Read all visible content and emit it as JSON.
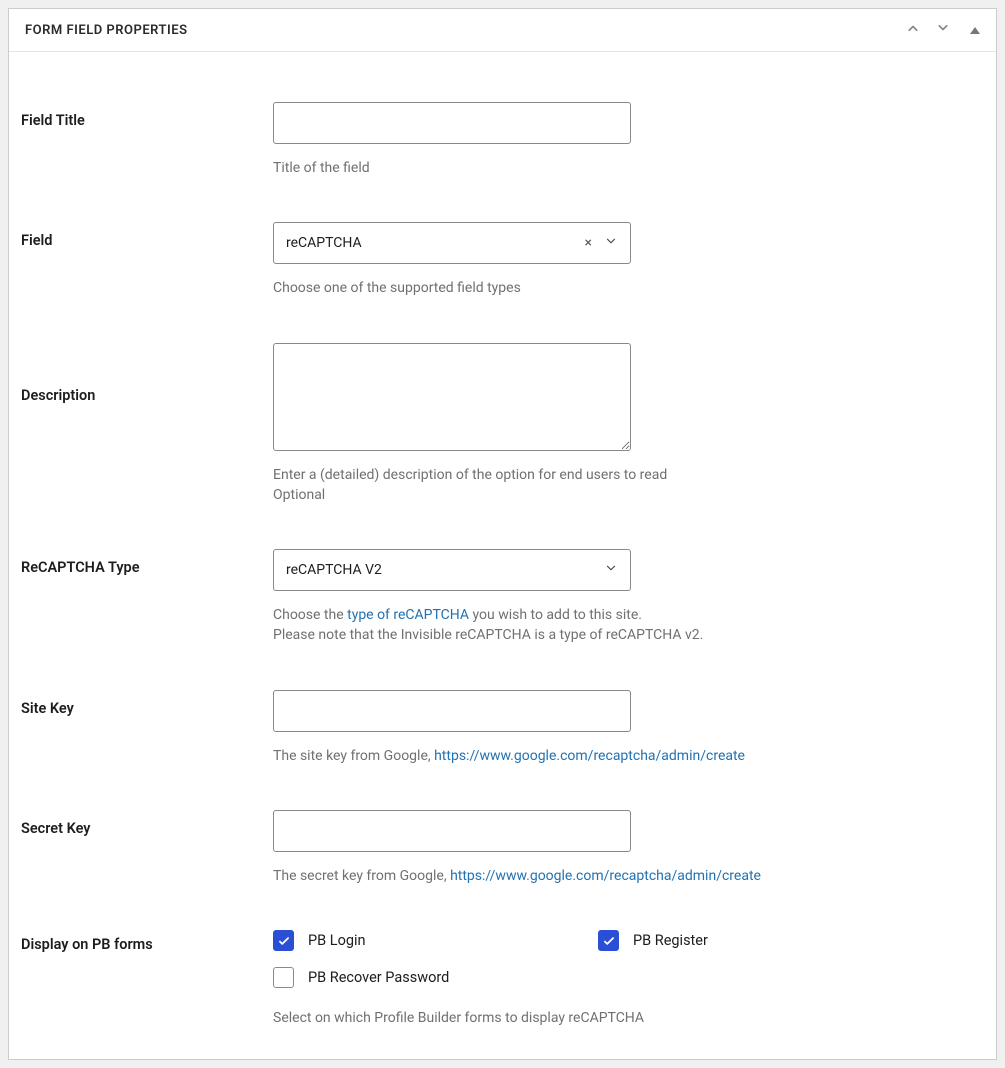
{
  "panel": {
    "title": "FORM FIELD PROPERTIES"
  },
  "fields": {
    "field_title": {
      "label": "Field Title",
      "value": "",
      "help": "Title of the field"
    },
    "field": {
      "label": "Field",
      "value": "reCAPTCHA",
      "help": "Choose one of the supported field types"
    },
    "description": {
      "label": "Description",
      "value": "",
      "help": "Enter a (detailed) description of the option for end users to read\nOptional"
    },
    "recaptcha_type": {
      "label": "ReCAPTCHA Type",
      "value": "reCAPTCHA V2",
      "help_pre": "Choose the ",
      "help_link": "type of reCAPTCHA",
      "help_post": " you wish to add to this site.\nPlease note that the Invisible reCAPTCHA is a type of reCAPTCHA v2."
    },
    "site_key": {
      "label": "Site Key",
      "value": "",
      "help_pre": "The site key from Google, ",
      "help_link": "https://www.google.com/recaptcha/admin/create"
    },
    "secret_key": {
      "label": "Secret Key",
      "value": "",
      "help_pre": "The secret key from Google, ",
      "help_link": "https://www.google.com/recaptcha/admin/create"
    },
    "display_pb": {
      "label": "Display on PB forms",
      "options": {
        "login": {
          "label": "PB Login",
          "checked": true
        },
        "register": {
          "label": "PB Register",
          "checked": true
        },
        "recover": {
          "label": "PB Recover Password",
          "checked": false
        }
      },
      "help": "Select on which Profile Builder forms to display reCAPTCHA"
    }
  }
}
